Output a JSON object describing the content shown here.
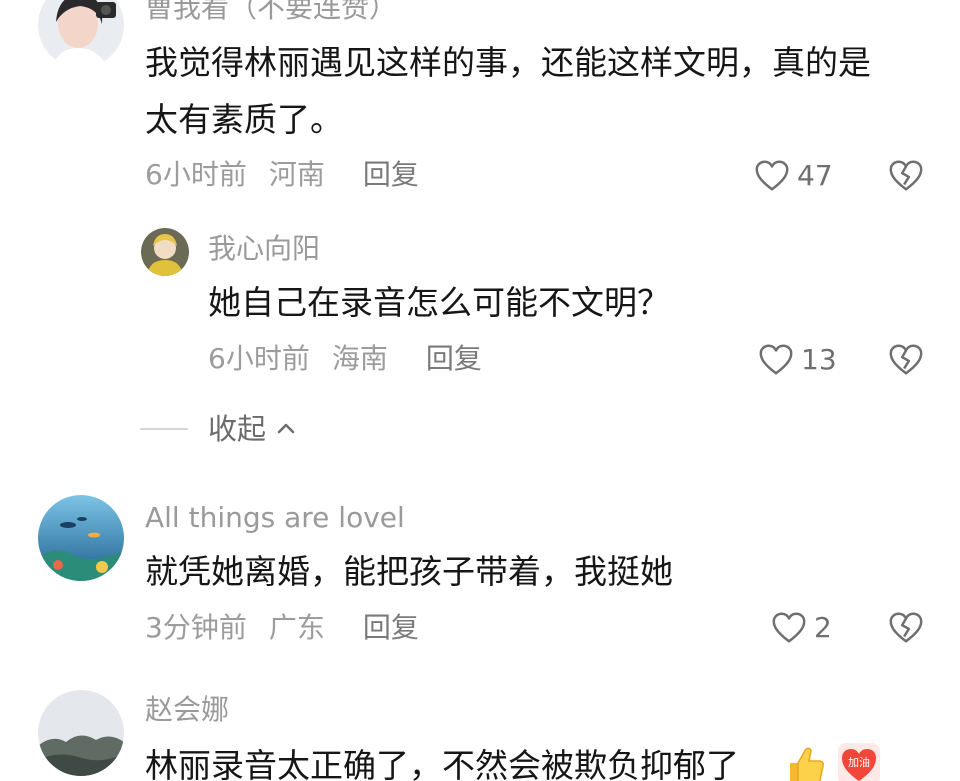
{
  "comments": [
    {
      "username": "曹我看（不要连赞）",
      "lines": [
        "我觉得林丽遇见这样的事，还能这样文明，真的是",
        "太有素质了。"
      ],
      "time": "6小时前",
      "location": "河南",
      "reply_label": "回复",
      "likes": "47",
      "replies": [
        {
          "username": "我心向阳",
          "lines": [
            "她自己在录音怎么可能不文明？"
          ],
          "time": "6小时前",
          "location": "海南",
          "reply_label": "回复",
          "likes": "13"
        }
      ],
      "collapse_label": "收起"
    },
    {
      "username": "All things are lovel",
      "lines": [
        "就凭她离婚，能把孩子带着，我挺她"
      ],
      "time": "3分钟前",
      "location": "广东",
      "reply_label": "回复",
      "likes": "2"
    },
    {
      "username": "赵会娜",
      "lines": [
        "林丽录音太正确了，不然会被欺负抑郁了"
      ],
      "stickers": [
        "thumbs-up-sticker",
        "jiayou-sticker"
      ],
      "sticker_text": "加油"
    }
  ],
  "icons": {
    "like": "heart-outline-icon",
    "dislike": "broken-heart-icon",
    "collapse": "chevron-up-icon"
  },
  "colors": {
    "text": "#161616",
    "secondary": "#9c9c9c",
    "icon": "#6f6f6f"
  }
}
